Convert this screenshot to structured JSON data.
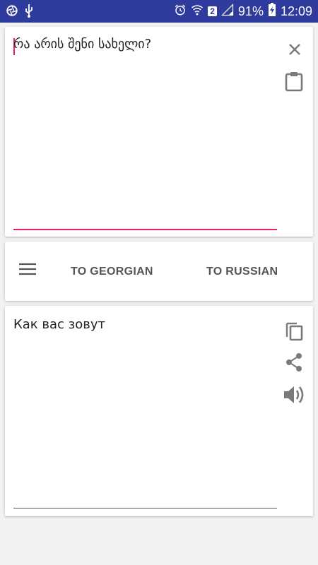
{
  "status_bar": {
    "battery_percent": "91%",
    "time": "12:09",
    "sim_badge": "2",
    "icons": [
      "aperture-icon",
      "usb-icon",
      "alarm-icon",
      "wifi-icon",
      "signal-icon",
      "battery-charging-icon"
    ]
  },
  "input": {
    "text": "რა არის შენი სახელი?",
    "accent_color": "#e91e63",
    "actions": [
      "close-icon",
      "paste-icon"
    ]
  },
  "toolbar": {
    "menu_icon": "menu-icon",
    "to_georgian_label": "TO GEORGIAN",
    "to_russian_label": "TO RUSSIAN"
  },
  "output": {
    "text": "Как вас зовут",
    "actions": [
      "copy-icon",
      "share-icon",
      "speaker-icon"
    ]
  },
  "colors": {
    "status_bar": "#2e3a9c",
    "background": "#f2f2f2",
    "icon_gray": "#7a7a7a"
  }
}
